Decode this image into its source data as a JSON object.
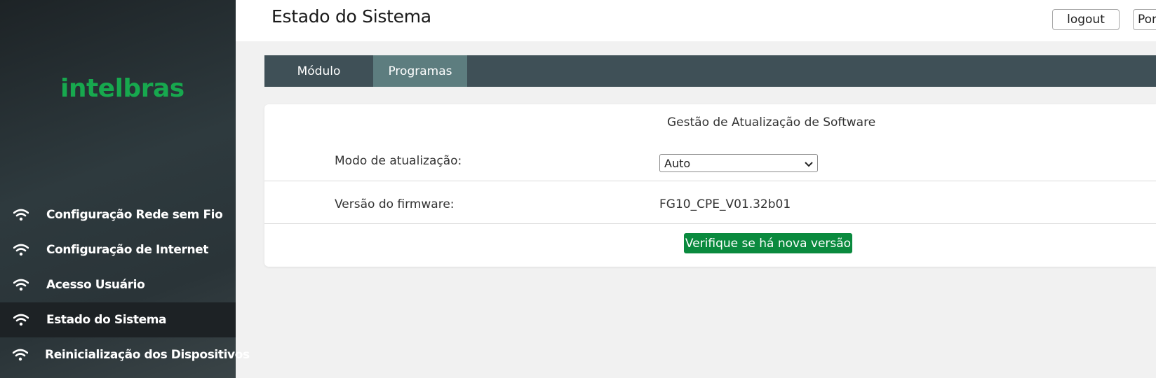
{
  "brand": {
    "logo_text": "intelbras",
    "logo_color": "#17a84e"
  },
  "sidebar": {
    "items": [
      {
        "label": "Configuração Rede sem Fio",
        "icon": "wifi-icon",
        "active": false
      },
      {
        "label": "Configuração de Internet",
        "icon": "wifi-icon",
        "active": false
      },
      {
        "label": "Acesso Usuário",
        "icon": "wifi-icon",
        "active": false
      },
      {
        "label": "Estado do Sistema",
        "icon": "wifi-icon",
        "active": true
      },
      {
        "label": "Reinicialização dos Dispositivos",
        "icon": "wifi-icon",
        "active": false
      }
    ]
  },
  "header": {
    "title": "Estado do Sistema",
    "logout_label": "logout",
    "language_label": "Por"
  },
  "tabs": [
    {
      "label": "Módulo",
      "active": false
    },
    {
      "label": "Programas",
      "active": true
    }
  ],
  "panel": {
    "title": "Gestão de Atualização de Software",
    "update_mode_label": "Modo de atualização:",
    "update_mode_value": "Auto",
    "firmware_label": "Versão do firmware:",
    "firmware_value": "FG10_CPE_V01.32b01",
    "check_button_label": "Verifique se há nova versão"
  },
  "colors": {
    "accent_green": "#0a8a3e",
    "tabbar_bg": "#3f5057",
    "tab_active_bg": "#5d7d7f"
  }
}
